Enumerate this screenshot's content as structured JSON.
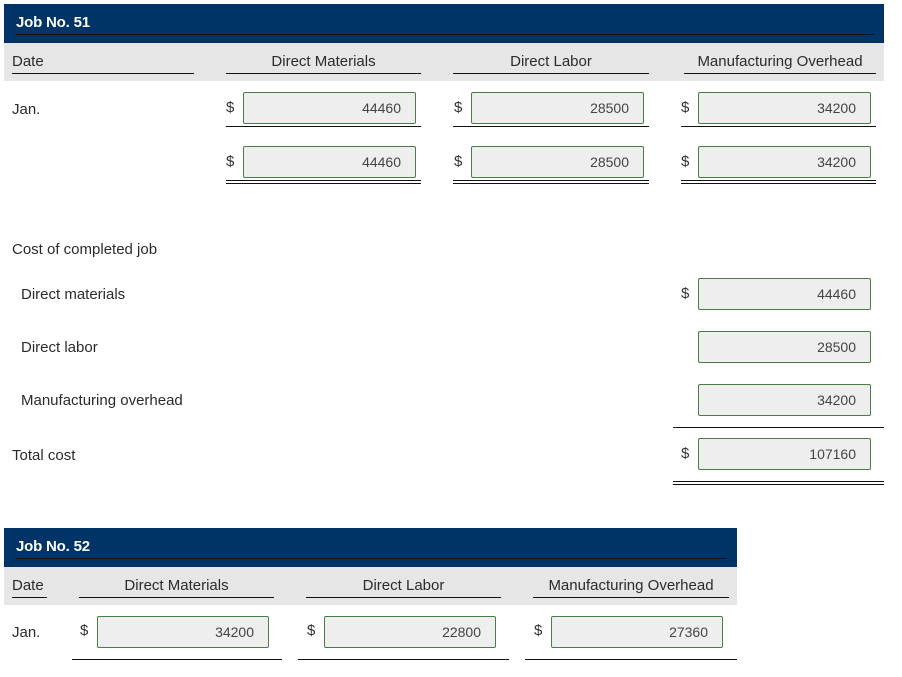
{
  "job51": {
    "title": "Job No. 51",
    "headers": {
      "date": "Date",
      "direct_materials": "Direct Materials",
      "direct_labor": "Direct Labor",
      "manufacturing_overhead": "Manufacturing Overhead"
    },
    "rows": [
      {
        "date": "Jan.",
        "direct_materials": "44460",
        "direct_labor": "28500",
        "manufacturing_overhead": "34200"
      },
      {
        "date": "",
        "direct_materials": "44460",
        "direct_labor": "28500",
        "manufacturing_overhead": "34200"
      }
    ],
    "currency_symbol": "$",
    "completed": {
      "heading": "Cost of completed job",
      "direct_materials_label": "Direct materials",
      "direct_materials_value": "44460",
      "direct_labor_label": "Direct labor",
      "direct_labor_value": "28500",
      "manufacturing_overhead_label": "Manufacturing overhead",
      "manufacturing_overhead_value": "34200",
      "total_label": "Total cost",
      "total_value": "107160"
    }
  },
  "job52": {
    "title": "Job No. 52",
    "headers": {
      "date": "Date",
      "direct_materials": "Direct Materials",
      "direct_labor": "Direct Labor",
      "manufacturing_overhead": "Manufacturing Overhead"
    },
    "rows": [
      {
        "date": "Jan.",
        "direct_materials": "34200",
        "direct_labor": "22800",
        "manufacturing_overhead": "27360"
      }
    ],
    "currency_symbol": "$"
  },
  "colors": {
    "title_bar": "#003366",
    "header_band": "#e6e6e6",
    "field_bg": "#eeeeee",
    "field_border": "#4a7c4a"
  }
}
